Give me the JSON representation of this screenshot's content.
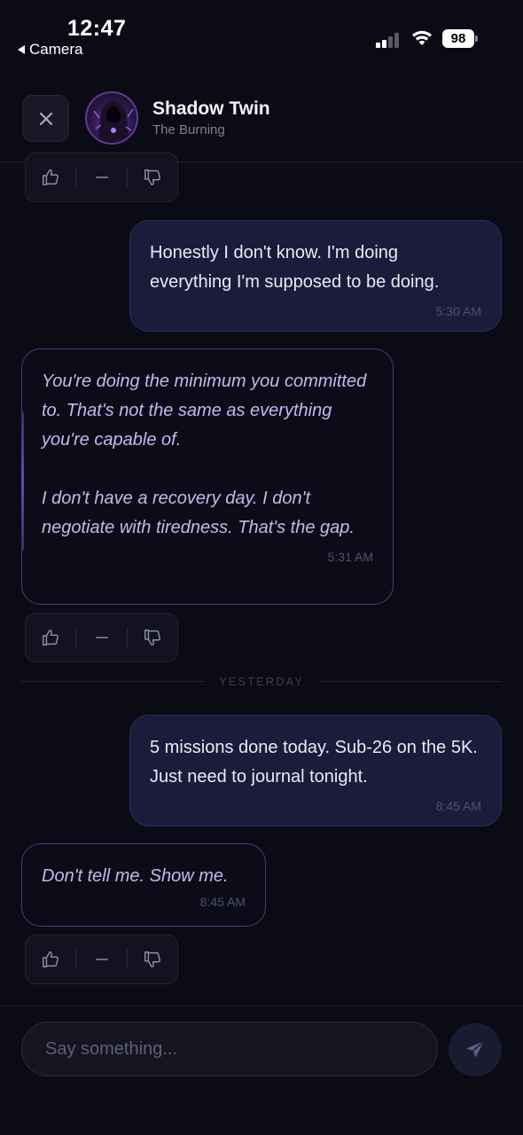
{
  "status_bar": {
    "time": "12:47",
    "back_app": "Camera",
    "battery": "98"
  },
  "header": {
    "title": "Shadow Twin",
    "subtitle": "The Burning",
    "close_icon": "close-icon",
    "avatar": "hooded-figure-avatar"
  },
  "messages": [
    {
      "role": "user",
      "text": "Honestly I don't know. I'm doing everything I'm supposed to be doing.",
      "time": "5:30 AM"
    },
    {
      "role": "bot",
      "text": "You're doing the minimum you committed to. That's not the same as everything you're capable of.\n\nI don't have a recovery day. I don't negotiate with tiredness. That's the gap.",
      "time": "5:31 AM"
    },
    {
      "role": "user",
      "text": "5 missions done today. Sub-26 on the 5K. Just need to journal tonight.",
      "time": "8:45 AM"
    },
    {
      "role": "bot",
      "text": "Don't tell me. Show me.",
      "time": "8:45 AM"
    }
  ],
  "divider": {
    "label": "YESTERDAY"
  },
  "composer": {
    "placeholder": "Say something...",
    "send_icon": "send-icon"
  },
  "colors": {
    "background": "#0b0b16",
    "user_bubble": "#1b1b3c",
    "bot_border": "#4a3a78",
    "bot_text": "#c6b8ec"
  }
}
